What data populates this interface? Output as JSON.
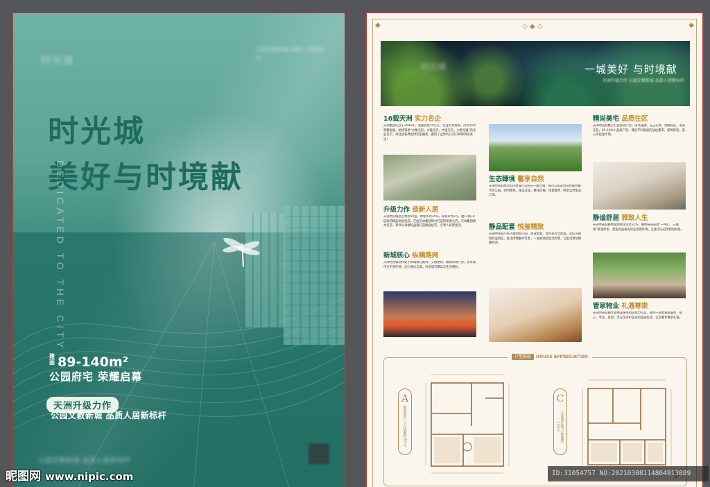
{
  "poster": {
    "logo": "时光城",
    "title_line1": "时光城",
    "title_line2": "美好与时境献",
    "vertical_text": "DEDICATED TO THE CITY",
    "area_prefix": "建面",
    "area": "89-140m²",
    "subtitle": "公园府宅 荣耀启幕",
    "badge": "天洲升级力作",
    "subtitle2": "公园文教新城 品质人居新标杆"
  },
  "doc": {
    "hero_title": "一城美好 与时境献",
    "hero_sub": "天洲升级力作 公园文教新城 品质人居新标杆",
    "col1": {
      "s1_title": "16载天洲",
      "s1_hl": "实力名企",
      "s1_text": "天洲集团成立于2006年，注册资金10亿元，企业实力雄厚。历经16年稳健发展，始终秉承“大象无形，大爱无声，大道无名，大善无疆”的企业哲学，为社会各界提供完美服务，赢得了业界的认可口碑和持续关注！",
      "s2_title": "升级力作",
      "s2_hl": "造新人居",
      "s2_text": "天洲时光城总占地近60亩，绿化率达35%，容积率为2.5，由11栋18层高的精品高层组成。在由天洲集团倾力打造的新城之后，天洲集团倾力打造，项目以高端的品质打造精品住宅，引领人居新生活。",
      "s3_title": "新城核心",
      "s3_hl": "纵横路网",
      "s3_text": "天洲时光城项目处于新城核心板块，交通便利，路网四通八达，多条城市主干道环绕，出行通达全城，尽享城市繁华与生活便利。"
    },
    "col2": {
      "s1_title": "生态臻境",
      "s1_hl": "馨享自然",
      "s1_text": "天洲时光城毗邻420亩城市公园与一路之隔，城市公园是目前所规划最大的公园，四时景色，生态宜居，繁花似锦，绿意盎然，畅享自然生态之美。",
      "s2_title": "静品配套",
      "s2_hl": "悦鉴精致",
      "s2_text": "天洲时光城小区内规划幼儿园、商业配套、会所等齐全配套，社区内规划商业街区，生活所需触手可及，一站式满足生活所需，让生活更加便捷舒适。",
      "photo_note": "实景图"
    },
    "col3": {
      "s1_title": "精尚美宅",
      "s1_hl": "品质住区",
      "s1_text": "天洲时光城精心打造舒适户型，南北通透，方正实用，动静分区，采光充足，89-140m²品质户型，满足不同家庭的居住需求，提供舒适、安心的居住环境。",
      "s2_title": "静谧舒居",
      "s2_hl": "雅致人生",
      "s2_text": "天洲时光城整体规划绿化率达35%，整体布局采用“一中心、三轴线”景观体系，营造高品质的社区景观环境，让生活与自然和谐共生。",
      "s3_title": "管家物业",
      "s3_hl": "礼遇尊崇",
      "s3_text": "天洲时光城由专业物业服务团队倾力打造，提供一站式管家服务，贴心、专业、高效，全方位守护业主的品质生活，让您尊享尊崇礼遇。"
    },
    "plans": {
      "title_tag": "户型赏析",
      "title_en": "HOUSE APPRECIATION",
      "a_letter": "A",
      "a_text": "两室两厅一卫 建面约89m²",
      "c_letter": "C",
      "c_text": "三室两厅两卫 建面约118m²"
    }
  },
  "watermark": {
    "site": "昵图网",
    "url": "www.nipic.com",
    "id_text": "ID:31054757 NO:20210308114804913089"
  }
}
